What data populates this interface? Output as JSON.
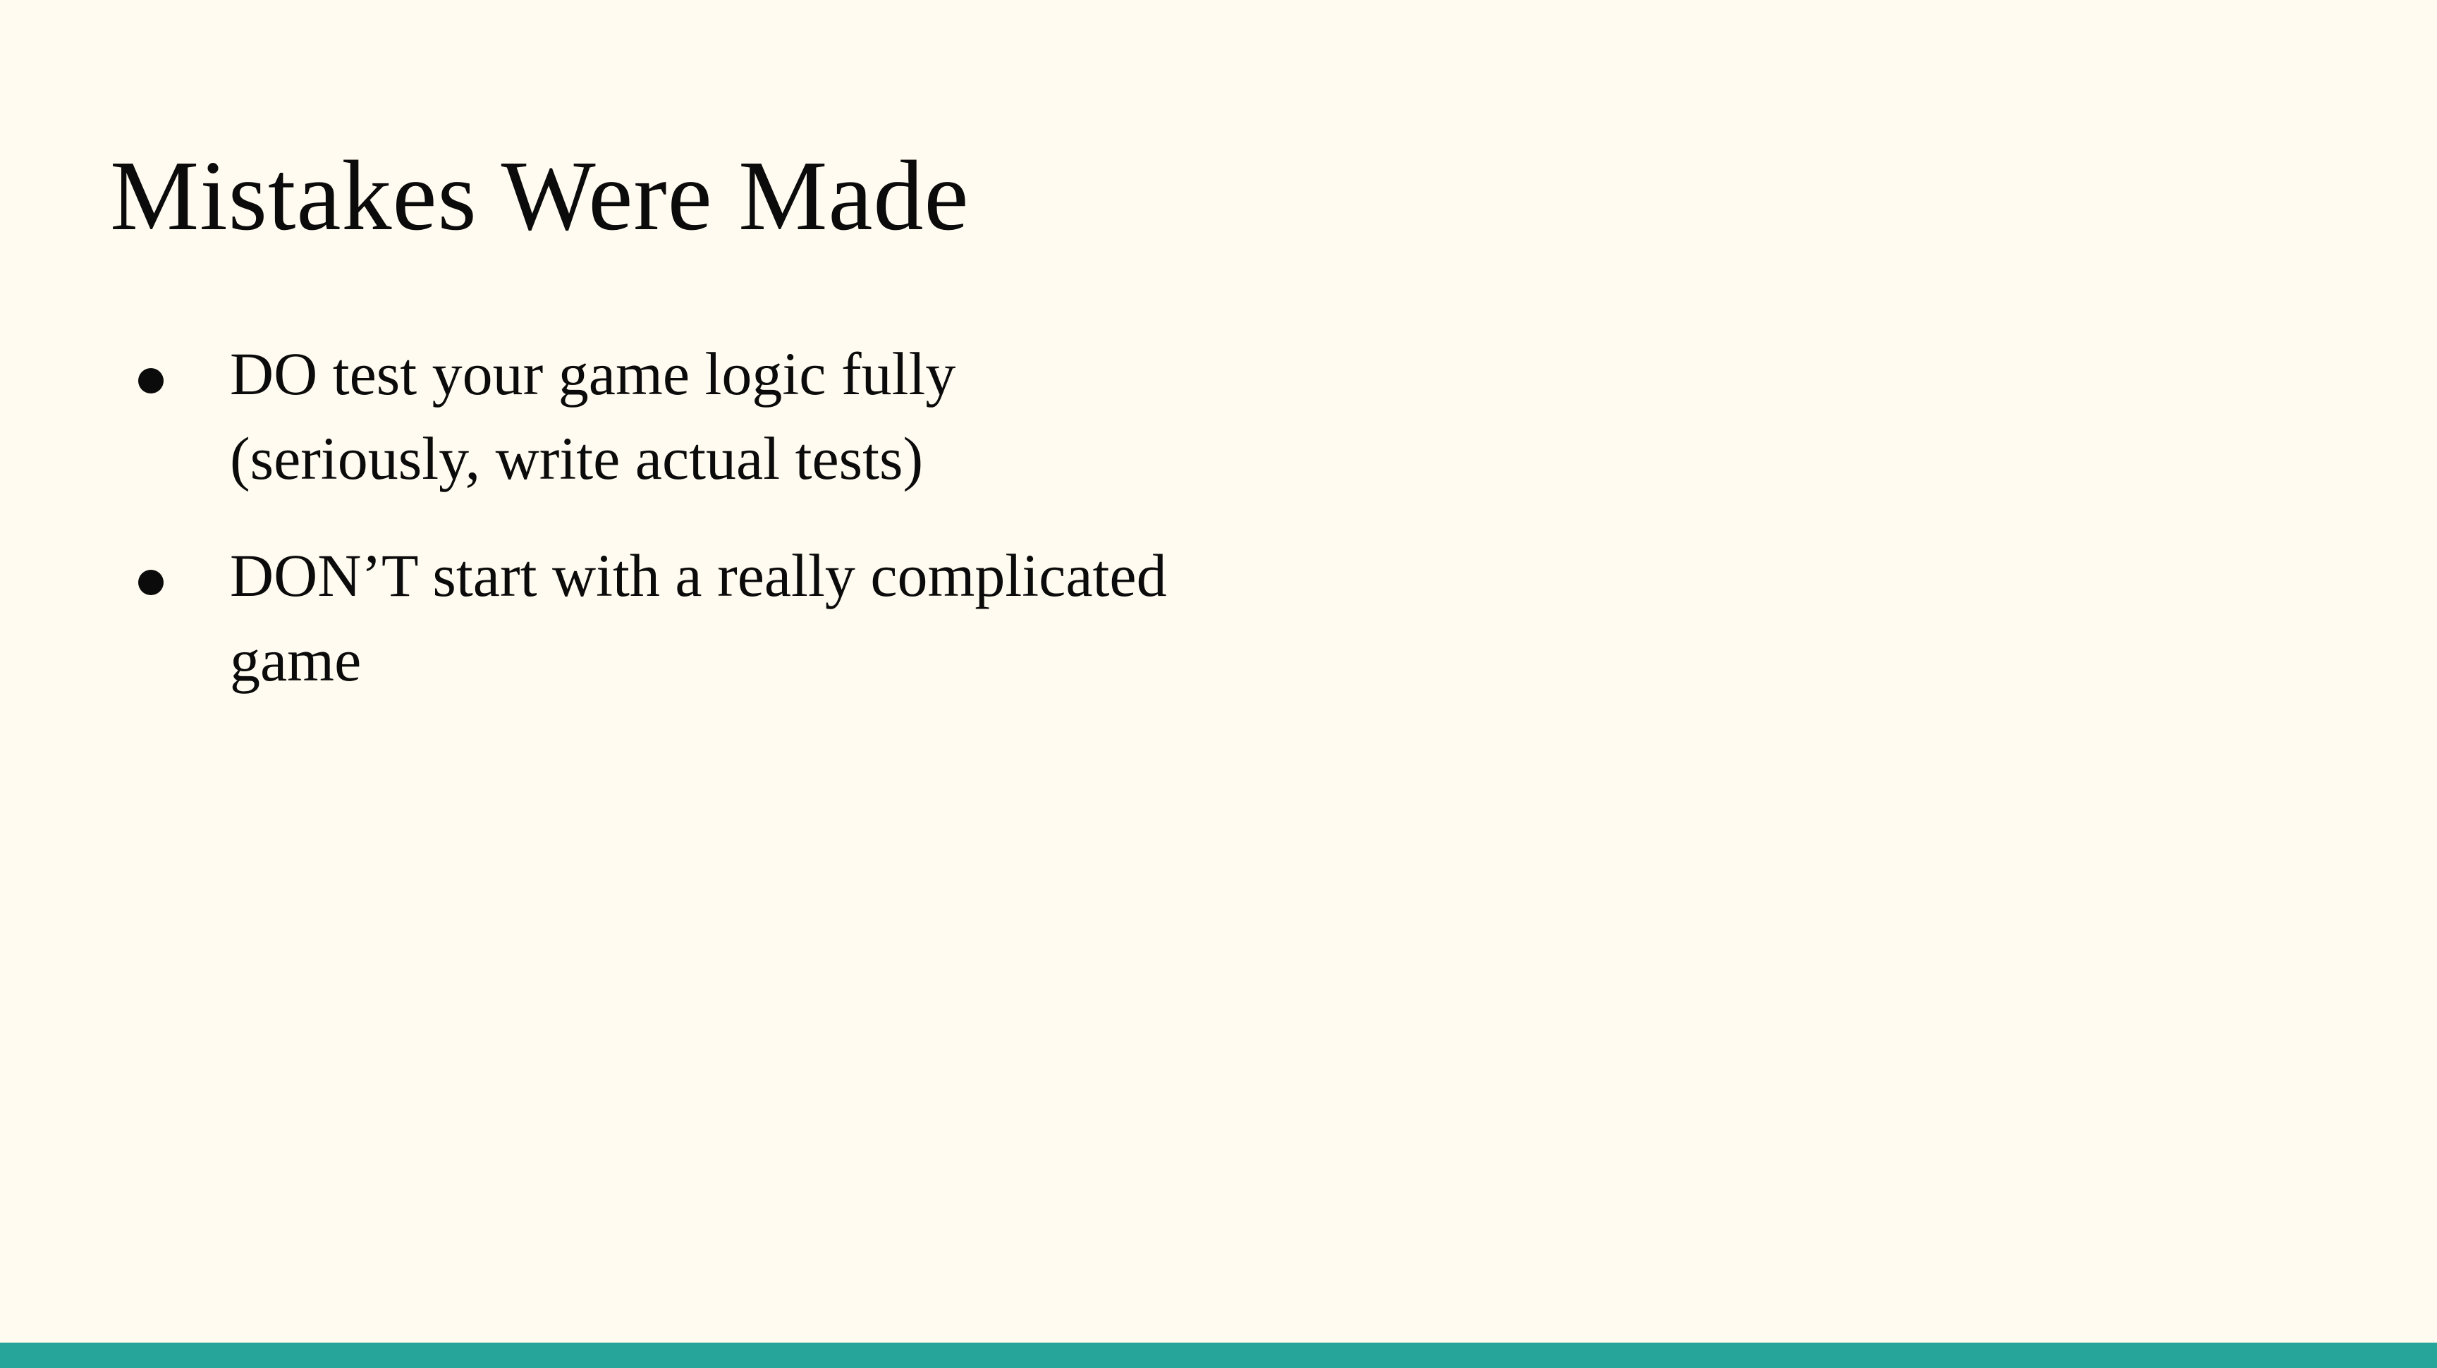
{
  "slide": {
    "title": "Mistakes Were Made",
    "bullets": [
      {
        "lines": [
          "DO test your game logic fully",
          "(seriously, write actual tests)"
        ]
      },
      {
        "lines": [
          "DON’T start with a really complicated",
          "game"
        ]
      }
    ]
  },
  "colors": {
    "background": "#fffbf0",
    "text": "#0b0b0b",
    "accent_bar": "#26a69a"
  }
}
